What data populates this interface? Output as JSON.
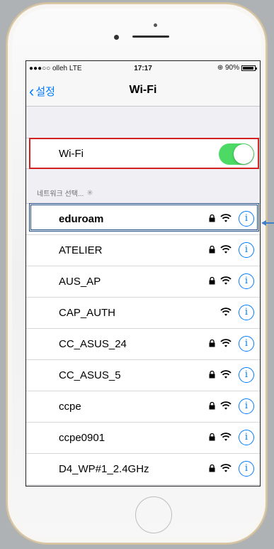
{
  "status": {
    "carrier": "●●●○○ olleh  LTE",
    "time": "17:17",
    "battery_text": "⊕ 90%"
  },
  "nav": {
    "back_label": "설정",
    "title": "Wi-Fi"
  },
  "wifi_toggle": {
    "label": "Wi-Fi",
    "state": "on"
  },
  "section": {
    "header": "네트워크 선택..."
  },
  "networks": [
    {
      "name": "eduroam",
      "locked": true
    },
    {
      "name": "ATELIER",
      "locked": true
    },
    {
      "name": "AUS_AP",
      "locked": true
    },
    {
      "name": "CAP_AUTH",
      "locked": false
    },
    {
      "name": "CC_ASUS_24",
      "locked": true
    },
    {
      "name": "CC_ASUS_5",
      "locked": true
    },
    {
      "name": "ccpe",
      "locked": true
    },
    {
      "name": "ccpe0901",
      "locked": true
    },
    {
      "name": "D4_WP#1_2.4GHz",
      "locked": true
    }
  ],
  "colors": {
    "accent": "#007aff",
    "toggle_on": "#4cd964",
    "highlight_red": "#d32020",
    "highlight_blue": "#1f4a84"
  }
}
